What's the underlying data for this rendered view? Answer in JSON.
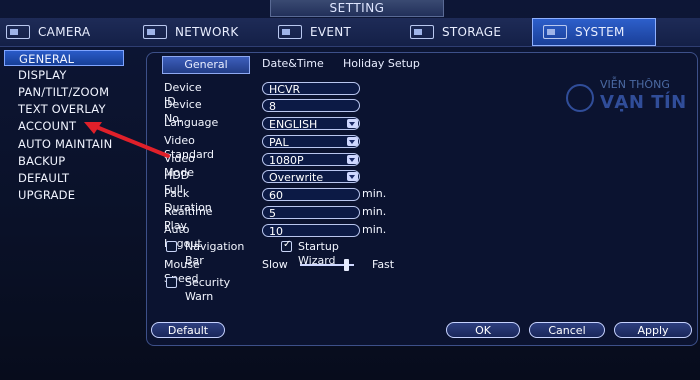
{
  "window": {
    "title": "SETTING"
  },
  "top_tabs": [
    {
      "label": "CAMERA"
    },
    {
      "label": "NETWORK"
    },
    {
      "label": "EVENT"
    },
    {
      "label": "STORAGE"
    },
    {
      "label": "SYSTEM",
      "active": true
    }
  ],
  "sidebar": {
    "items": [
      {
        "label": "GENERAL",
        "active": true
      },
      {
        "label": "DISPLAY"
      },
      {
        "label": "PAN/TILT/ZOOM"
      },
      {
        "label": "TEXT OVERLAY"
      },
      {
        "label": "ACCOUNT"
      },
      {
        "label": "AUTO MAINTAIN"
      },
      {
        "label": "BACKUP"
      },
      {
        "label": "DEFAULT"
      },
      {
        "label": "UPGRADE"
      }
    ]
  },
  "subtabs": [
    {
      "label": "General",
      "active": true
    },
    {
      "label": "Date&Time"
    },
    {
      "label": "Holiday Setup"
    }
  ],
  "form": {
    "device_id": {
      "label": "Device ID",
      "value": "HCVR"
    },
    "device_no": {
      "label": "Device No.",
      "value": "8"
    },
    "language": {
      "label": "Language",
      "value": "ENGLISH"
    },
    "video_standard": {
      "label": "Video Standard",
      "value": "PAL"
    },
    "video_mode": {
      "label": "Video Mode",
      "value": "1080P"
    },
    "hdd_full": {
      "label": "HDD Full",
      "value": "Overwrite"
    },
    "pack_duration": {
      "label": "Pack Duration",
      "value": "60",
      "unit": "min."
    },
    "realtime_play": {
      "label": "Realtime Play",
      "value": "5",
      "unit": "min."
    },
    "auto_logout": {
      "label": "Auto Logout",
      "value": "10",
      "unit": "min."
    },
    "navigation_bar": {
      "label": "Navigation Bar",
      "checked": false
    },
    "startup_wizard": {
      "label": "Startup Wizard",
      "checked": true
    },
    "mouse_speed": {
      "label": "Mouse Speed",
      "slow": "Slow",
      "fast": "Fast",
      "level": 0.9
    },
    "security_warn": {
      "label": "Security Warn",
      "checked": false
    }
  },
  "buttons": {
    "default": "Default",
    "ok": "OK",
    "cancel": "Cancel",
    "apply": "Apply"
  },
  "watermark": {
    "top": "VIỄN THÔNG",
    "brand": "VẠN TÍN"
  },
  "colors": {
    "accent": "#2a5bc8",
    "arrow": "#e0202a"
  }
}
